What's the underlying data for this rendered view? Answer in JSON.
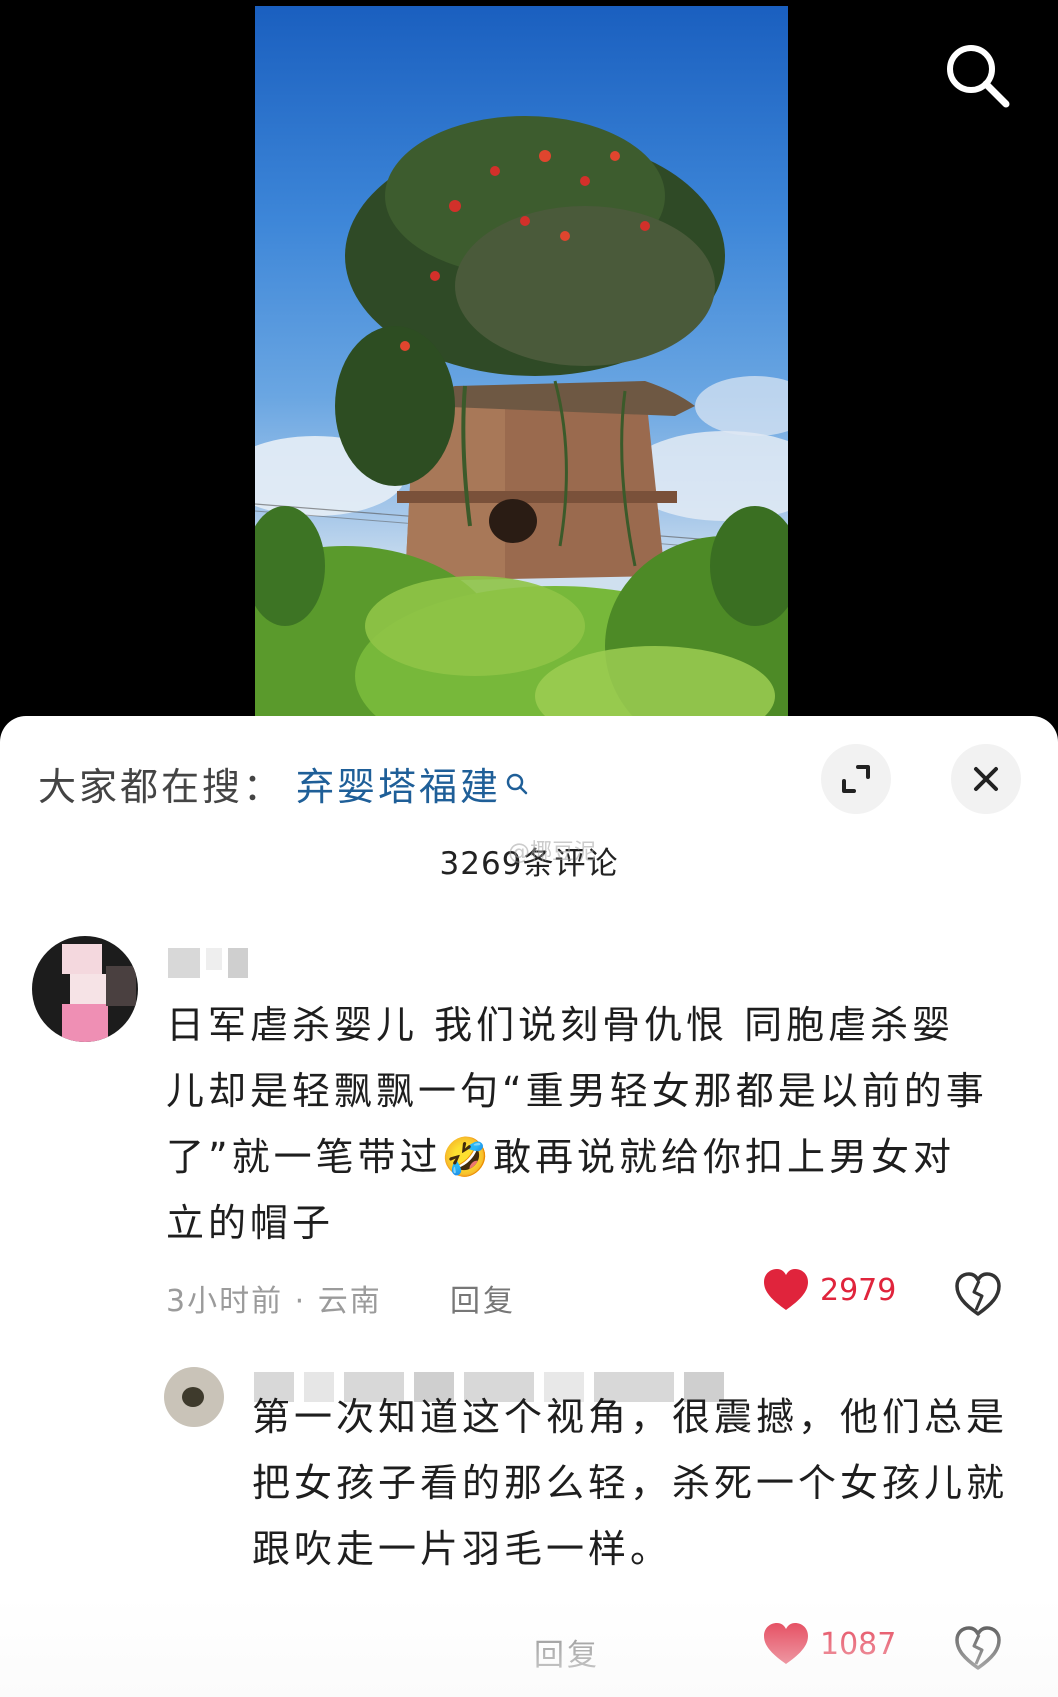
{
  "top_bar": {
    "search_icon": "search-icon"
  },
  "hot_search": {
    "label": "大家都在搜：",
    "query": "弃婴塔福建",
    "icon": "search-icon"
  },
  "sheet_controls": {
    "expand_icon": "expand-icon",
    "close_icon": "close-icon"
  },
  "comments_header": {
    "count_label": "3269条评论",
    "watermark": "@椰豆泥"
  },
  "comments": [
    {
      "text": "日军虐杀婴儿 我们说刻骨仇恨 同胞虐杀婴儿却是轻飘飘一句“重男轻女那都是以前的事了”就一笔带过🤣敢再说就给你扣上男女对立的帽子",
      "meta": "3小时前 · 云南",
      "reply_label": "回复",
      "likes": "2979"
    },
    {
      "text": "第一次知道这个视角，很震撼，他们总是把女孩子看的那么轻，杀死一个女孩儿就跟吹走一片羽毛一样。",
      "reply_label": "回复",
      "likes": "1087"
    }
  ],
  "colors": {
    "accent_link": "#1f5f98",
    "like_red": "#e0243c",
    "meta_gray": "#9b9b9b"
  }
}
